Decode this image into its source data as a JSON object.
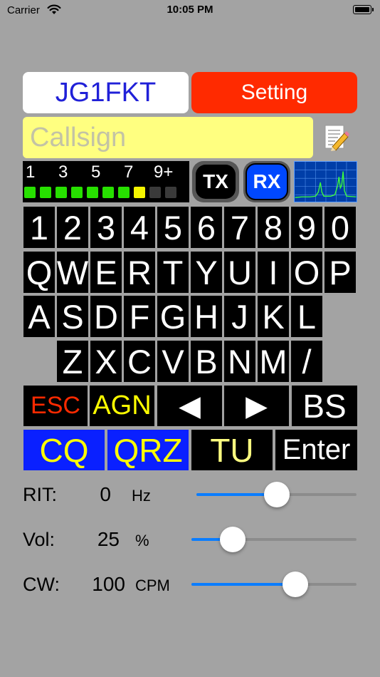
{
  "status_bar": {
    "carrier": "Carrier",
    "time": "10:05 PM"
  },
  "header": {
    "callsign_button": "JG1FKT",
    "setting_button": "Setting"
  },
  "callsign_field": {
    "placeholder": "Callsign",
    "value": ""
  },
  "smeter": {
    "scale": [
      "1",
      "3",
      "5",
      "7",
      "9+"
    ],
    "leds": [
      "green",
      "green",
      "green",
      "green",
      "green",
      "green",
      "green",
      "yellow",
      "off",
      "off"
    ]
  },
  "tx_label": "TX",
  "rx_label": "RX",
  "keyboard": {
    "row1": [
      "1",
      "2",
      "3",
      "4",
      "5",
      "6",
      "7",
      "8",
      "9",
      "0"
    ],
    "row2": [
      "Q",
      "W",
      "E",
      "R",
      "T",
      "Y",
      "U",
      "I",
      "O",
      "P"
    ],
    "row3": [
      "A",
      "S",
      "D",
      "F",
      "G",
      "H",
      "J",
      "K",
      "L"
    ],
    "row4": [
      "Z",
      "X",
      "C",
      "V",
      "B",
      "N",
      "M",
      "/"
    ]
  },
  "func_row1": {
    "esc": "ESC",
    "agn": "AGN",
    "left": "◀",
    "right": "▶",
    "bs": "BS"
  },
  "func_row2": {
    "cq": "CQ",
    "qrz": "QRZ",
    "tu": "TU",
    "enter": "Enter"
  },
  "sliders": [
    {
      "label": "RIT:",
      "value": "0",
      "unit": "Hz",
      "level": 0.5
    },
    {
      "label": "Vol:",
      "value": "25",
      "unit": "%",
      "level": 0.25
    },
    {
      "label": "CW:",
      "value": "100",
      "unit": "CPM",
      "level": 0.63
    }
  ],
  "colors": {
    "background": "#a3a3a3",
    "callsign_text": "#2020d8",
    "setting_bg": "#ff2a00",
    "input_bg": "#ffff80",
    "led_green": "#27e000",
    "led_yellow": "#f5f500",
    "led_off": "#3a3a3a",
    "rx_blue": "#0048ff",
    "esc_red": "#ff2a00",
    "agn_yellow": "#ffff00",
    "cq_blue": "#0a20ff",
    "slider_blue": "#0a7dff"
  },
  "icons": {
    "wifi": "wifi-icon",
    "battery": "battery-icon",
    "memo": "memo-pencil-icon",
    "spectrum": "spectrum-scope-icon"
  }
}
